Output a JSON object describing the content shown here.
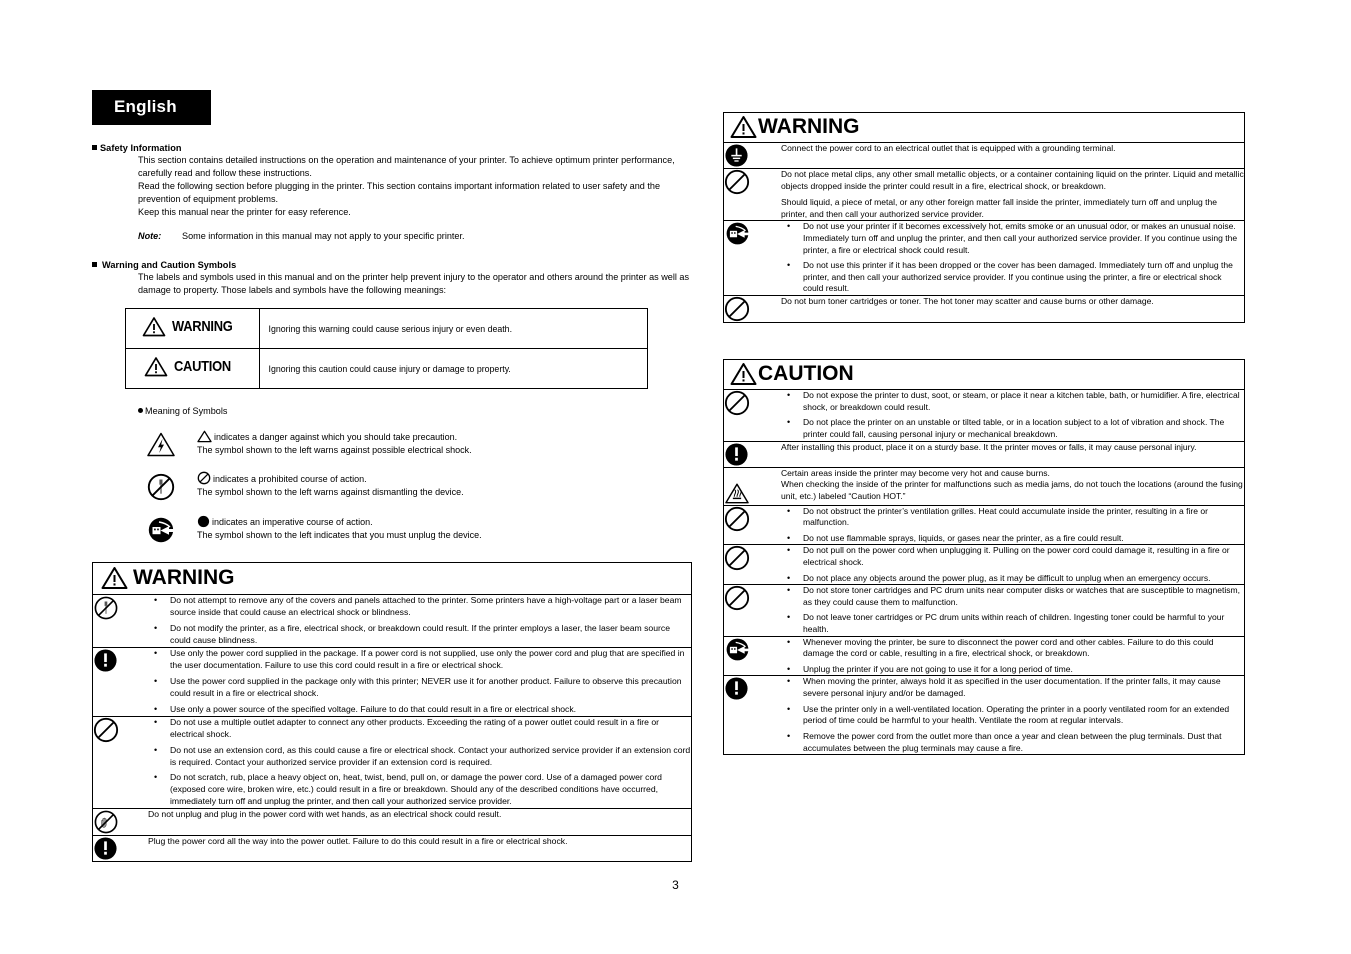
{
  "language_tab": "English",
  "page_number": "3",
  "safety_information": {
    "heading": "Safety Information",
    "para1": "This section contains detailed instructions on the operation and maintenance of your printer. To achieve optimum printer performance, carefully read and follow these instructions.",
    "para2": "Read the following section before plugging in the printer. This section contains important information related to user safety and the prevention of equipment problems.",
    "para3": "Keep this manual near the printer for easy reference.",
    "note_label": "Note:",
    "note_text": "Some information in this manual may not apply to your specific printer."
  },
  "warning_caution_symbols": {
    "heading": "Warning and Caution Symbols",
    "intro": "The labels and symbols used in this manual and on the printer help prevent injury to the operator and others around the printer as well as damage to property. Those labels and symbols have the following meanings:",
    "rows": [
      {
        "symbol_label": "WARNING",
        "icon": "warning-triangle-icon",
        "meaning": "Ignoring this warning could cause serious injury or even death."
      },
      {
        "symbol_label": "CAUTION",
        "icon": "warning-triangle-icon",
        "meaning": "Ignoring this caution could cause injury or damage to property."
      }
    ]
  },
  "meaning_of_symbols": {
    "heading": "Meaning of Symbols",
    "items": [
      {
        "icon": "electrical-shock-triangle-icon",
        "line1": "indicates a danger against which you should take precaution.",
        "line2": "The symbol shown to the left warns against possible electrical shock.",
        "inline_icon": "triangle-outline-icon"
      },
      {
        "icon": "no-dismantle-icon",
        "line1": "indicates a prohibited course of action.",
        "line2": "The symbol shown to the left warns against dismantling the device.",
        "inline_icon": "prohibition-circle-icon"
      },
      {
        "icon": "unplug-device-icon",
        "line1": "indicates an imperative course of action.",
        "line2": "The symbol shown to the left indicates that you must unplug the device.",
        "inline_icon": "filled-circle-icon"
      }
    ]
  },
  "warning_panel_left": {
    "title": "WARNING",
    "title_icon": "warning-triangle-icon",
    "rows": [
      {
        "icon": "no-dismantle-icon",
        "bullets": [
          "Do not attempt to remove any of the covers and panels attached to the printer. Some printers have a high-voltage part or a laser beam source inside that could cause an electrical shock or blindness.",
          "Do not modify the printer, as a fire, electrical shock, or breakdown could result. If the printer employs a laser, the laser beam source could cause blindness."
        ]
      },
      {
        "icon": "imperative-exclamation-icon",
        "bullets": [
          "Use only the power cord supplied in the package. If a power cord is not supplied, use only the power cord and plug that are specified in the user documentation. Failure to use this cord could result in a fire or electrical shock.",
          "Use the power cord supplied in the package only with this printer; NEVER use it for another product. Failure to observe this precaution could result in a fire or electrical shock.",
          "Use only a power source of the specified voltage. Failure to do that could result in a fire or electrical shock."
        ]
      },
      {
        "icon": "prohibition-circle-icon",
        "bullets": [
          "Do not use a multiple outlet adapter to connect any other products. Exceeding the rating of a power outlet could result in a fire or electrical shock.",
          "Do not use an extension cord, as this could cause a fire or electrical shock. Contact your authorized service provider if an extension cord is required. Contact your authorized service provider if an extension cord is required.",
          "Do not scratch, rub, place a heavy object on, heat, twist, bend, pull on, or damage the power cord. Use of a damaged power cord (exposed core wire, broken wire, etc.) could result in a fire or breakdown. Should any of the described conditions have occurred, immediately turn off and unplug the printer, and then call your authorized service provider."
        ]
      },
      {
        "icon": "no-wet-hands-icon",
        "paragraphs": [
          "Do not unplug and plug in the power cord with wet hands, as an electrical shock could result."
        ]
      },
      {
        "icon": "imperative-exclamation-icon",
        "paragraphs": [
          "Plug the power cord all the way into the power outlet. Failure to do this could result in a fire or electrical shock."
        ]
      }
    ]
  },
  "warning_panel_right": {
    "title": "WARNING",
    "title_icon": "warning-triangle-icon",
    "rows": [
      {
        "icon": "grounding-terminal-icon",
        "paragraphs": [
          "Connect the power cord to an electrical outlet that is equipped with a grounding terminal."
        ]
      },
      {
        "icon": "prohibition-circle-icon",
        "paragraphs": [
          "Do not place metal clips, any other small metallic objects, or a container containing liquid on the printer. Liquid and metallic objects dropped inside the printer could result in a fire, electrical shock, or breakdown.",
          "Should liquid, a piece of metal, or any other foreign matter fall inside the printer, immediately turn off and unplug the printer, and then call your authorized service provider."
        ]
      },
      {
        "icon": "unplug-device-icon",
        "bullets": [
          "Do not use your printer if it becomes excessively hot, emits smoke or an unusual odor, or makes an unusual noise. Immediately turn off and unplug the printer, and then call your authorized service provider. If you continue using the printer, a fire or electrical shock could result.",
          "Do not use this printer if it has been dropped or the cover has been damaged. Immediately turn off and unplug the printer, and then call your authorized service provider. If you continue using the printer, a fire or electrical shock could result."
        ]
      },
      {
        "icon": "prohibition-circle-icon",
        "paragraphs": [
          "Do not burn toner cartridges or toner. The hot toner may scatter and cause burns or other damage."
        ]
      }
    ]
  },
  "caution_panel_right": {
    "title": "CAUTION",
    "title_icon": "warning-triangle-icon",
    "rows": [
      {
        "icon": "prohibition-circle-icon",
        "bullets": [
          "Do not expose the printer to dust, soot, or steam, or place it near a kitchen table, bath, or humidifier. A fire, electrical shock, or breakdown could result.",
          "Do not place the printer on an unstable or tilted table, or in a location subject to a lot of vibration and shock. The printer could fall, causing personal injury or mechanical breakdown."
        ]
      },
      {
        "icon": "imperative-exclamation-icon",
        "paragraphs": [
          "After installing this product, place it on a sturdy base. It the printer moves or falls, it may cause personal injury."
        ]
      },
      {
        "icon": "hot-surface-triangle-icon",
        "paragraphs": [
          "Certain areas inside the printer may become very hot and cause burns.",
          "When checking the inside of the printer for malfunctions such as media jams, do not touch the locations (around the fusing unit, etc.) labeled “Caution HOT.”"
        ]
      },
      {
        "icon": "prohibition-circle-icon",
        "bullets": [
          "Do not obstruct the printer’s ventilation grilles. Heat could accumulate inside the printer, resulting in a fire or malfunction.",
          "Do not use flammable sprays, liquids, or gases near the printer, as a fire could result."
        ]
      },
      {
        "icon": "prohibition-circle-icon",
        "bullets": [
          "Do not pull on the power cord when unplugging it. Pulling on the power cord could damage it, resulting in a fire or electrical shock.",
          "Do not place any objects around the power plug, as it may be difficult to unplug when an emergency occurs."
        ]
      },
      {
        "icon": "prohibition-circle-icon",
        "bullets": [
          "Do not store toner cartridges and PC drum units near computer disks or watches that are susceptible to magnetism, as they could cause them to malfunction.",
          "Do not leave toner cartridges or PC drum units within reach of children. Ingesting toner could be harmful to your health."
        ]
      },
      {
        "icon": "unplug-device-icon",
        "bullets": [
          "Whenever moving the printer, be sure to disconnect the power cord and other cables. Failure to do this could damage the cord or cable, resulting in a fire, electrical shock, or breakdown.",
          "Unplug the printer if you are not going to use it for a long period of time."
        ]
      },
      {
        "icon": "imperative-exclamation-icon",
        "bullets": [
          "When moving the printer, always hold it as specified in the user documentation. If the printer falls, it may cause severe personal injury and/or be damaged.",
          "Use the printer only in a well-ventilated location. Operating the printer in a poorly ventilated room for an extended period of time could be harmful to your health. Ventilate the room at regular intervals.",
          "Remove the power cord from the outlet more than once a year and clean between the plug terminals. Dust that accumulates between the plug terminals may cause a fire."
        ]
      }
    ]
  },
  "colors": {
    "ink": "#000000",
    "paper": "#ffffff"
  }
}
